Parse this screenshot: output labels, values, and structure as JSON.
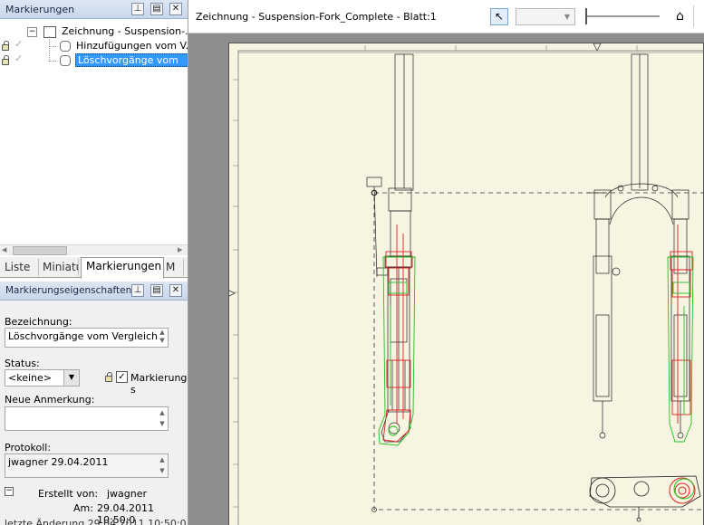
{
  "markup_panel": {
    "title": "Markierungen",
    "tree": {
      "root_label": "Zeichnung - Suspension-...",
      "child1_label": "Hinzufügungen vom V...",
      "child2_label": "Löschvorgänge vom"
    },
    "tabs": [
      {
        "label": "Liste"
      },
      {
        "label": "Miniatu"
      },
      {
        "label": "Markierungen"
      },
      {
        "label": "M"
      }
    ]
  },
  "properties_panel": {
    "title": "Markierungseigenschaften",
    "name_label": "Bezeichnung:",
    "name_value": "Löschvorgänge vom Vergleich",
    "status_label": "Status:",
    "status_value": "<keine>",
    "mark_checkbox_label": "Markierung s",
    "note_label": "Neue Anmerkung:",
    "note_value": "",
    "log_label": "Protokoll:",
    "log_value": "jwagner  29.04.2011",
    "created_by_label": "Erstellt von:",
    "created_by_value": "jwagner",
    "date_label": "Am:",
    "date_value": "29.04.2011  10:50:0",
    "last_row": "letzte Änderung  29.04.2011  10:50:0"
  },
  "document": {
    "title": "Zeichnung - Suspension-Fork_Complete - Blatt:1"
  },
  "colors": {
    "selected": "#3399ff",
    "sheet": "#f7f4e2",
    "canvas_bg": "#8e8e8e",
    "red_markup": "#e02020",
    "green_markup": "#20c020"
  }
}
